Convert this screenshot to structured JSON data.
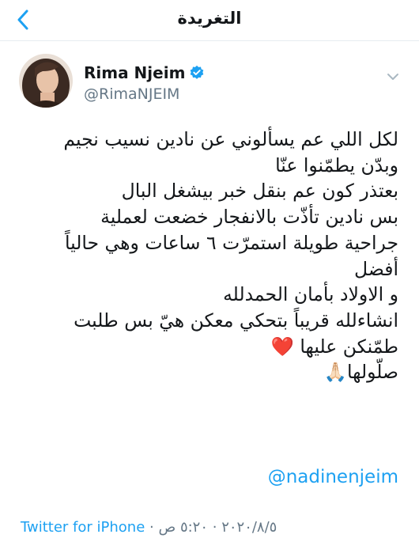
{
  "header": {
    "title": "التغريدة",
    "back_icon": "chevron-left-icon"
  },
  "author": {
    "name": "Rima Njeim",
    "handle": "@RimaNJEIM",
    "verified_icon": "verified-badge-icon",
    "avatar_icon": "avatar-photo"
  },
  "tweet": {
    "lines": [
      "لكل اللي عم يسألوني عن نادين نسيب نجيم",
      "وبدّن يطمّنوا عنّا",
      "بعتذر كون عم بنقل خبر بيشغل البال",
      "بس نادين تأذّت بالانفجار خضعت لعملية",
      "جراحية طويلة استمرّت ٦ ساعات وهي حالياً",
      "أفضل",
      "و الاولاد بأمان الحمدلله",
      "انشاءلله قريباً بتحكي معكن هيّ بس طلبت",
      "طمّنكن عليها ❤️",
      "صلّولها🙏🏻"
    ],
    "mention": "@nadinenjeim"
  },
  "meta": {
    "source": "Twitter for iPhone",
    "separator": " · ",
    "date": "٢٠٢٠/٨/٥",
    "time": "٥:٢٠ ص"
  },
  "colors": {
    "accent": "#1da1f2",
    "secondary_text": "#657786",
    "text": "#14171a"
  }
}
